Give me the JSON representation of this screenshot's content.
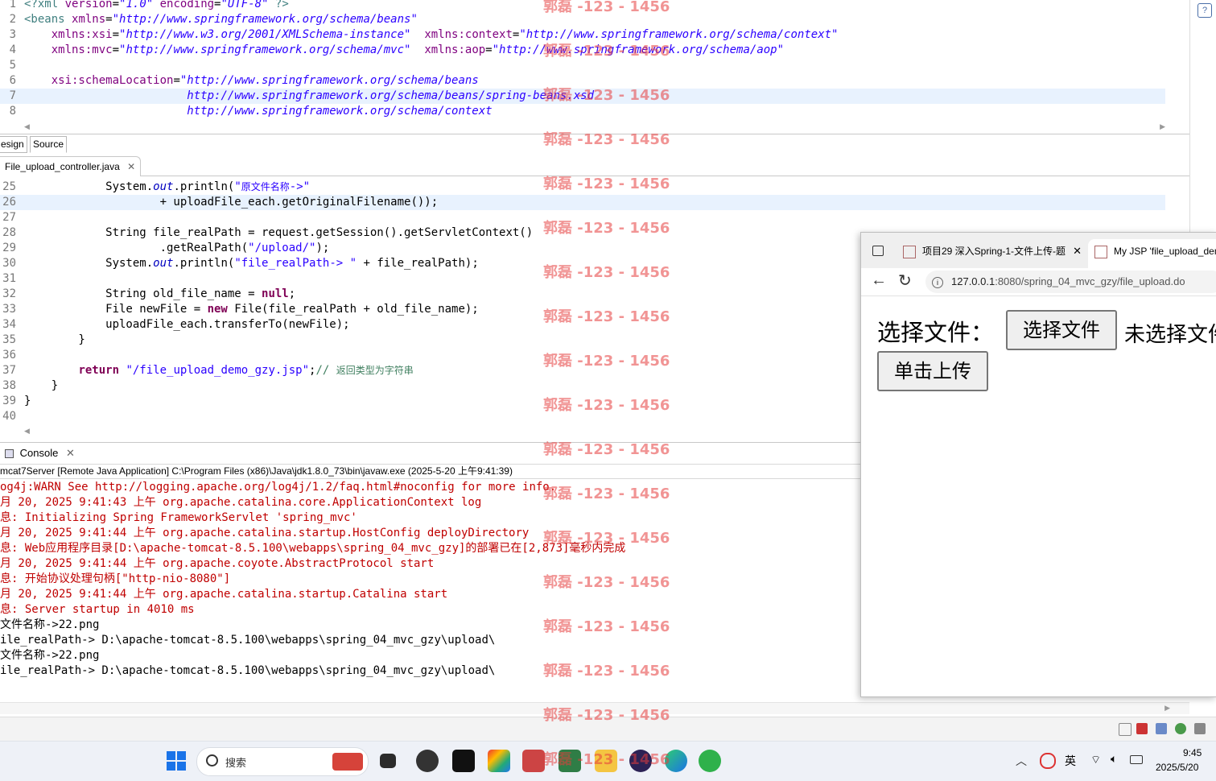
{
  "xml_editor": {
    "lines": [
      {
        "n": "1",
        "parts": [
          [
            "tag",
            "<?xml "
          ],
          [
            "attr",
            "version"
          ],
          [
            "",
            "="
          ],
          [
            "str",
            "\"1.0\""
          ],
          [
            "",
            ""
          ],
          [
            "attr",
            " encoding"
          ],
          [
            "",
            "="
          ],
          [
            "str",
            "\"UTF-8\""
          ],
          [
            "tag",
            " ?>"
          ]
        ]
      },
      {
        "n": "2",
        "parts": [
          [
            "tag",
            "<beans "
          ],
          [
            "attr",
            "xmlns"
          ],
          [
            "",
            "="
          ],
          [
            "str",
            "\"http://www.springframework.org/schema/beans\""
          ]
        ]
      },
      {
        "n": "3",
        "parts": [
          [
            "",
            "    "
          ],
          [
            "attr",
            "xmlns:xsi"
          ],
          [
            "",
            "="
          ],
          [
            "str",
            "\"http://www.w3.org/2001/XMLSchema-instance\""
          ],
          [
            "",
            "  "
          ],
          [
            "attr",
            "xmlns:context"
          ],
          [
            "",
            "="
          ],
          [
            "str",
            "\"http://www.springframework.org/schema/context\""
          ]
        ]
      },
      {
        "n": "4",
        "parts": [
          [
            "",
            "    "
          ],
          [
            "attr",
            "xmlns:mvc"
          ],
          [
            "",
            "="
          ],
          [
            "str",
            "\"http://www.springframework.org/schema/mvc\""
          ],
          [
            "",
            "  "
          ],
          [
            "attr",
            "xmlns:aop"
          ],
          [
            "",
            "="
          ],
          [
            "str",
            "\"http://www.springframework.org/schema/aop\""
          ]
        ]
      },
      {
        "n": "5",
        "parts": [
          [
            "",
            ""
          ]
        ]
      },
      {
        "n": "6",
        "parts": [
          [
            "",
            "    "
          ],
          [
            "attr",
            "xsi:schemaLocation"
          ],
          [
            "",
            "="
          ],
          [
            "str",
            "\"http://www.springframework.org/schema/beans"
          ]
        ]
      },
      {
        "n": "7",
        "parts": [
          [
            "",
            "                        "
          ],
          [
            "str",
            "http://www.springframework.org/schema/beans/spring-beans.xsd"
          ]
        ]
      },
      {
        "n": "8",
        "parts": [
          [
            "",
            "                        "
          ],
          [
            "str",
            "http://www.springframework.org/schema/context"
          ]
        ]
      }
    ],
    "tab_design": "esign",
    "tab_source": "Source"
  },
  "java_editor": {
    "tab_label": "File_upload_controller.java",
    "lines": [
      {
        "n": "25",
        "parts": [
          [
            "",
            "            System."
          ],
          [
            "field",
            "out"
          ],
          [
            "",
            ".println("
          ],
          [
            "jstr",
            "\""
          ],
          [
            "cjk-s",
            "原文件名称"
          ],
          [
            "jstr",
            "->\""
          ]
        ]
      },
      {
        "n": "26",
        "parts": [
          [
            "",
            "                    + uploadFile_each."
          ],
          [
            "",
            ""
          ],
          [
            "",
            "getOriginalFilename"
          ],
          [
            "",
            "());"
          ]
        ]
      },
      {
        "n": "27",
        "parts": [
          [
            "",
            ""
          ]
        ]
      },
      {
        "n": "28",
        "parts": [
          [
            "",
            "            String file_realPath = request.getSession().getServletContext()"
          ]
        ]
      },
      {
        "n": "29",
        "parts": [
          [
            "",
            "                    .getRealPath("
          ],
          [
            "jstr",
            "\"/upload/\""
          ],
          [
            "",
            ");"
          ]
        ]
      },
      {
        "n": "30",
        "parts": [
          [
            "",
            "            System."
          ],
          [
            "field",
            "out"
          ],
          [
            "",
            ".println("
          ],
          [
            "jstr",
            "\"file_realPath-> \""
          ],
          [
            "",
            " + file_realPath);"
          ]
        ]
      },
      {
        "n": "31",
        "parts": [
          [
            "",
            ""
          ]
        ]
      },
      {
        "n": "32",
        "parts": [
          [
            "",
            "            String old_file_name = "
          ],
          [
            "kw",
            "null"
          ],
          [
            "",
            ";"
          ]
        ]
      },
      {
        "n": "33",
        "parts": [
          [
            "",
            "            File newFile = "
          ],
          [
            "kw",
            "new"
          ],
          [
            "",
            " File(file_realPath + old_file_name);"
          ]
        ]
      },
      {
        "n": "34",
        "parts": [
          [
            "",
            "            uploadFile_each.transferTo(newFile);"
          ]
        ]
      },
      {
        "n": "35",
        "parts": [
          [
            "",
            "        }"
          ]
        ]
      },
      {
        "n": "36",
        "parts": [
          [
            "",
            ""
          ]
        ]
      },
      {
        "n": "37",
        "parts": [
          [
            "",
            "        "
          ],
          [
            "kw",
            "return"
          ],
          [
            "",
            " "
          ],
          [
            "jstr",
            "\"/file_upload_demo_gzy.jsp\""
          ],
          [
            "",
            ";"
          ],
          [
            "cmt",
            "// "
          ],
          [
            "cjk-c",
            "返回类型为字符串"
          ]
        ]
      },
      {
        "n": "38",
        "parts": [
          [
            "",
            "    }"
          ]
        ]
      },
      {
        "n": "39",
        "parts": [
          [
            "",
            "}"
          ]
        ]
      },
      {
        "n": "40",
        "parts": [
          [
            "",
            ""
          ]
        ]
      }
    ]
  },
  "console": {
    "tab_label": "Console",
    "header": "mcat7Server [Remote Java Application] C:\\Program Files (x86)\\Java\\jdk1.8.0_73\\bin\\javaw.exe (2025-5-20 上午9:41:39)",
    "lines": [
      {
        "text": "og4j:WARN See http://logging.apache.org/log4j/1.2/faq.html#noconfig for more info.",
        "red": true
      },
      {
        "text": "月 20, 2025 9:41:43 上午 org.apache.catalina.core.ApplicationContext log",
        "red": true
      },
      {
        "text": "息: Initializing Spring FrameworkServlet 'spring_mvc'",
        "red": true
      },
      {
        "text": "月 20, 2025 9:41:44 上午 org.apache.catalina.startup.HostConfig deployDirectory",
        "red": true
      },
      {
        "text": "息: Web应用程序目录[D:\\apache-tomcat-8.5.100\\webapps\\spring_04_mvc_gzy]的部署已在[2,873]毫秒内完成",
        "red": true
      },
      {
        "text": "月 20, 2025 9:41:44 上午 org.apache.coyote.AbstractProtocol start",
        "red": true
      },
      {
        "text": "息: 开始协议处理句柄[\"http-nio-8080\"]",
        "red": true
      },
      {
        "text": "月 20, 2025 9:41:44 上午 org.apache.catalina.startup.Catalina start",
        "red": true
      },
      {
        "text": "息: Server startup in 4010 ms",
        "red": true
      },
      {
        "text": "文件名称->22.png",
        "red": false
      },
      {
        "text": "ile_realPath-> D:\\apache-tomcat-8.5.100\\webapps\\spring_04_mvc_gzy\\upload\\",
        "red": false
      },
      {
        "text": "文件名称->22.png",
        "red": false
      },
      {
        "text": "ile_realPath-> D:\\apache-tomcat-8.5.100\\webapps\\spring_04_mvc_gzy\\upload\\",
        "red": false
      }
    ]
  },
  "browser": {
    "tab1_label": "项目29 深入Spring-1-文件上传-题",
    "tab2_label": "My JSP 'file_upload_demo",
    "url_host": "127.0.0.1",
    "url_path": ":8080/spring_04_mvc_gzy/file_upload.do",
    "form": {
      "label": "选择文件：",
      "choose_button": "选择文件",
      "no_file_text": "未选择文件",
      "submit_button": "单击上传"
    }
  },
  "taskbar": {
    "search_placeholder": "搜索",
    "ime": "英",
    "time": "9:45",
    "date": "2025/5/20"
  },
  "watermark": {
    "text": "郭磊 -123 - 1456"
  }
}
